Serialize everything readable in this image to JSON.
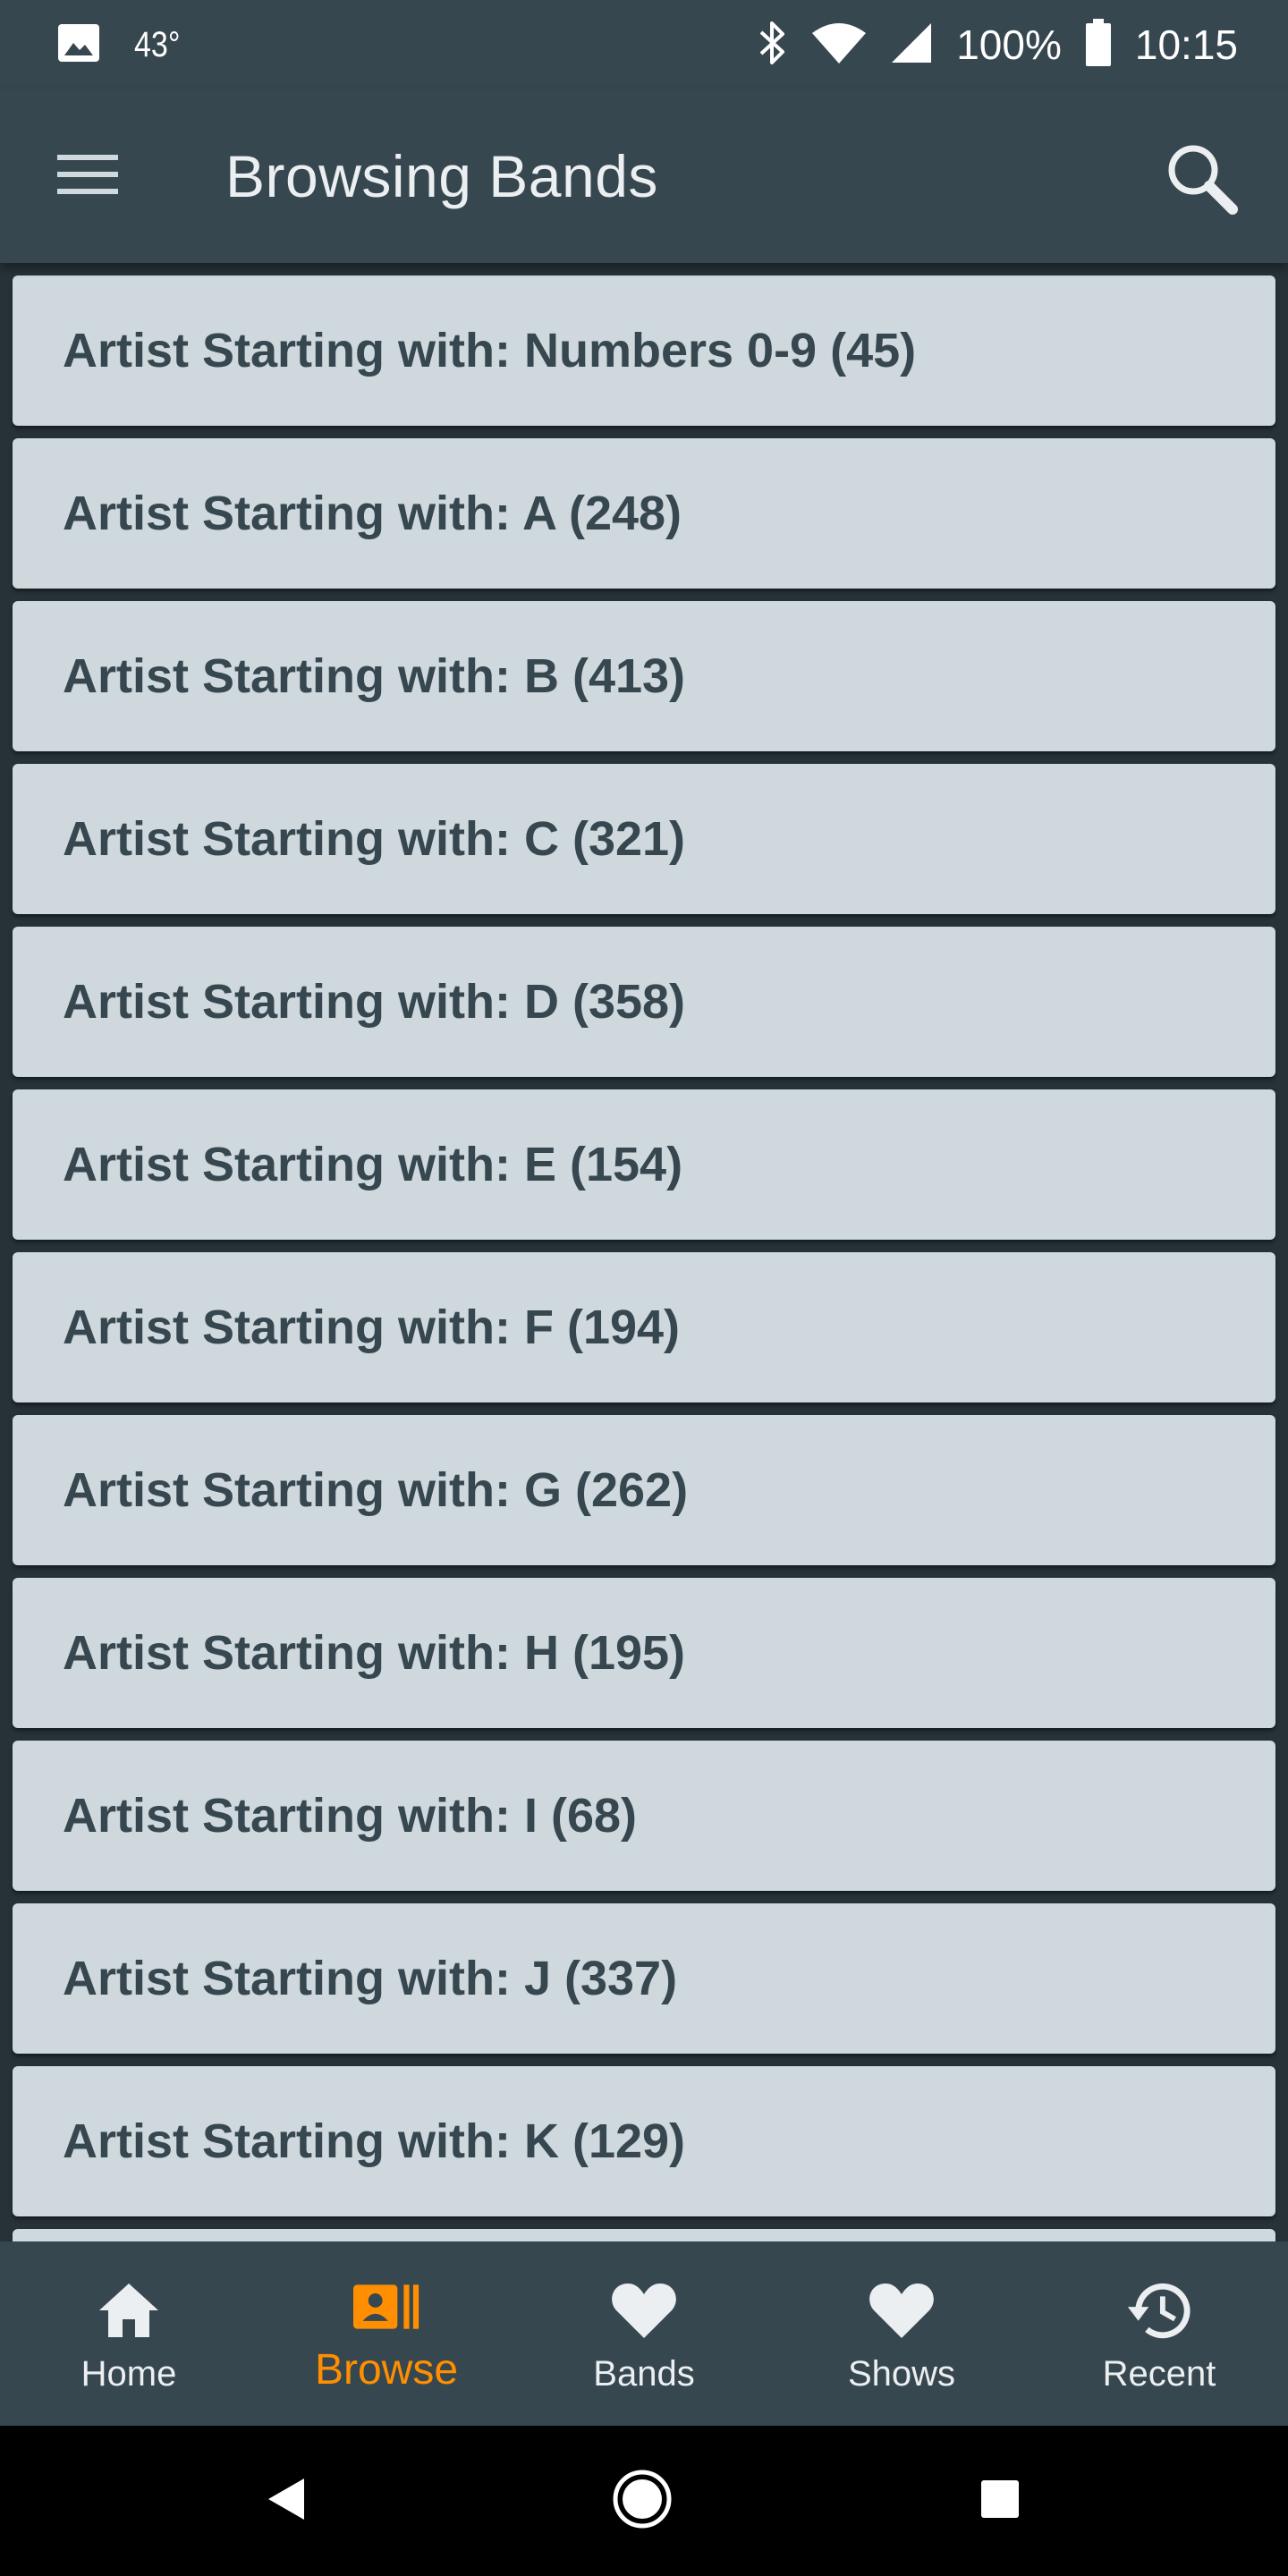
{
  "status_bar": {
    "temperature": "43°",
    "battery": "100%",
    "time": "10:15",
    "icons": [
      "image-icon",
      "bluetooth-icon",
      "wifi-icon",
      "cell-signal-icon",
      "battery-icon"
    ]
  },
  "app_bar": {
    "title": "Browsing Bands",
    "menu_icon": "hamburger-menu-icon",
    "search_icon": "search-icon"
  },
  "list": {
    "items": [
      {
        "label": "Artist Starting with: Numbers 0-9 (45)"
      },
      {
        "label": "Artist Starting with: A (248)"
      },
      {
        "label": "Artist Starting with: B (413)"
      },
      {
        "label": "Artist Starting with: C (321)"
      },
      {
        "label": "Artist Starting with: D (358)"
      },
      {
        "label": "Artist Starting with: E (154)"
      },
      {
        "label": "Artist Starting with: F (194)"
      },
      {
        "label": "Artist Starting with: G (262)"
      },
      {
        "label": "Artist Starting with: H (195)"
      },
      {
        "label": "Artist Starting with: I (68)"
      },
      {
        "label": "Artist Starting with: J (337)"
      },
      {
        "label": "Artist Starting with: K (129)"
      }
    ]
  },
  "bottom_nav": {
    "items": [
      {
        "label": "Home",
        "icon": "home-icon"
      },
      {
        "label": "Browse",
        "icon": "browse-icon",
        "active": true
      },
      {
        "label": "Bands",
        "icon": "heart-icon"
      },
      {
        "label": "Shows",
        "icon": "heart-icon"
      },
      {
        "label": "Recent",
        "icon": "history-icon"
      }
    ]
  },
  "colors": {
    "app_bar": "#37474f",
    "background": "#263238",
    "list_item": "#cfd8dc",
    "list_text": "#37474f",
    "accent": "#ff8f00"
  }
}
